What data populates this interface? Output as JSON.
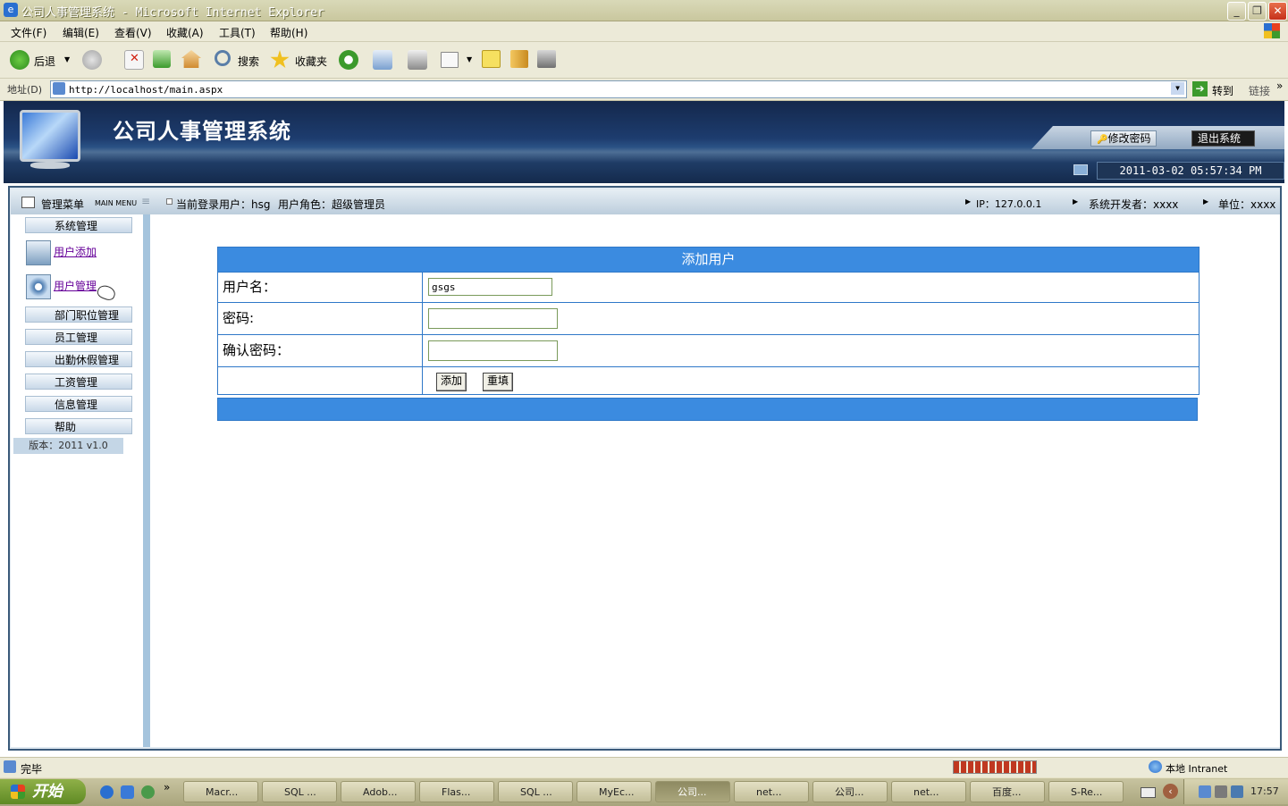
{
  "window": {
    "title": "公司人事管理系统 - Microsoft Internet Explorer"
  },
  "menubar": [
    "文件(F)",
    "编辑(E)",
    "查看(V)",
    "收藏(A)",
    "工具(T)",
    "帮助(H)"
  ],
  "toolbar": {
    "back": "后退",
    "search": "搜索",
    "favorites": "收藏夹"
  },
  "address": {
    "label": "地址(D)",
    "url": "http://localhost/main.aspx",
    "go": "转到",
    "links": "链接"
  },
  "app": {
    "title": "公司人事管理系统",
    "change_password": "修改密码",
    "logout": "退出系统",
    "datetime": "2011-03-02 05:57:34 PM"
  },
  "infobar": {
    "menu_title": "管理菜单",
    "menu_sub": "MAIN MENU",
    "current_user": "当前登录用户：hsg",
    "role": "用户角色：超级管理员",
    "ip": "IP：127.0.0.1",
    "developer": "系统开发者：xxxx",
    "unit": "单位：xxxx"
  },
  "sidebar": {
    "items": [
      "系统管理",
      "部门职位管理",
      "员工管理",
      "出勤休假管理",
      "工资管理",
      "信息管理",
      "帮助"
    ],
    "sub_links": [
      "用户添加",
      "用户管理"
    ],
    "version": "版本：2011 v1.0"
  },
  "form": {
    "title": "添加用户",
    "username_label": "用户名：",
    "username_value": "gsgs",
    "password_label": "密码:",
    "confirm_label": "确认密码：",
    "add_button": "添加",
    "reset_button": "重填"
  },
  "statusbar": {
    "status": "完毕",
    "zone": "本地 Intranet"
  },
  "taskbar": {
    "start": "开始",
    "tasks": [
      "Macr...",
      "SQL ...",
      "Adob...",
      "Flas...",
      "SQL ...",
      "MyEc...",
      "公司...",
      "net...",
      "公司...",
      "net...",
      "百度...",
      "S-Re..."
    ],
    "clock": "17:57"
  }
}
